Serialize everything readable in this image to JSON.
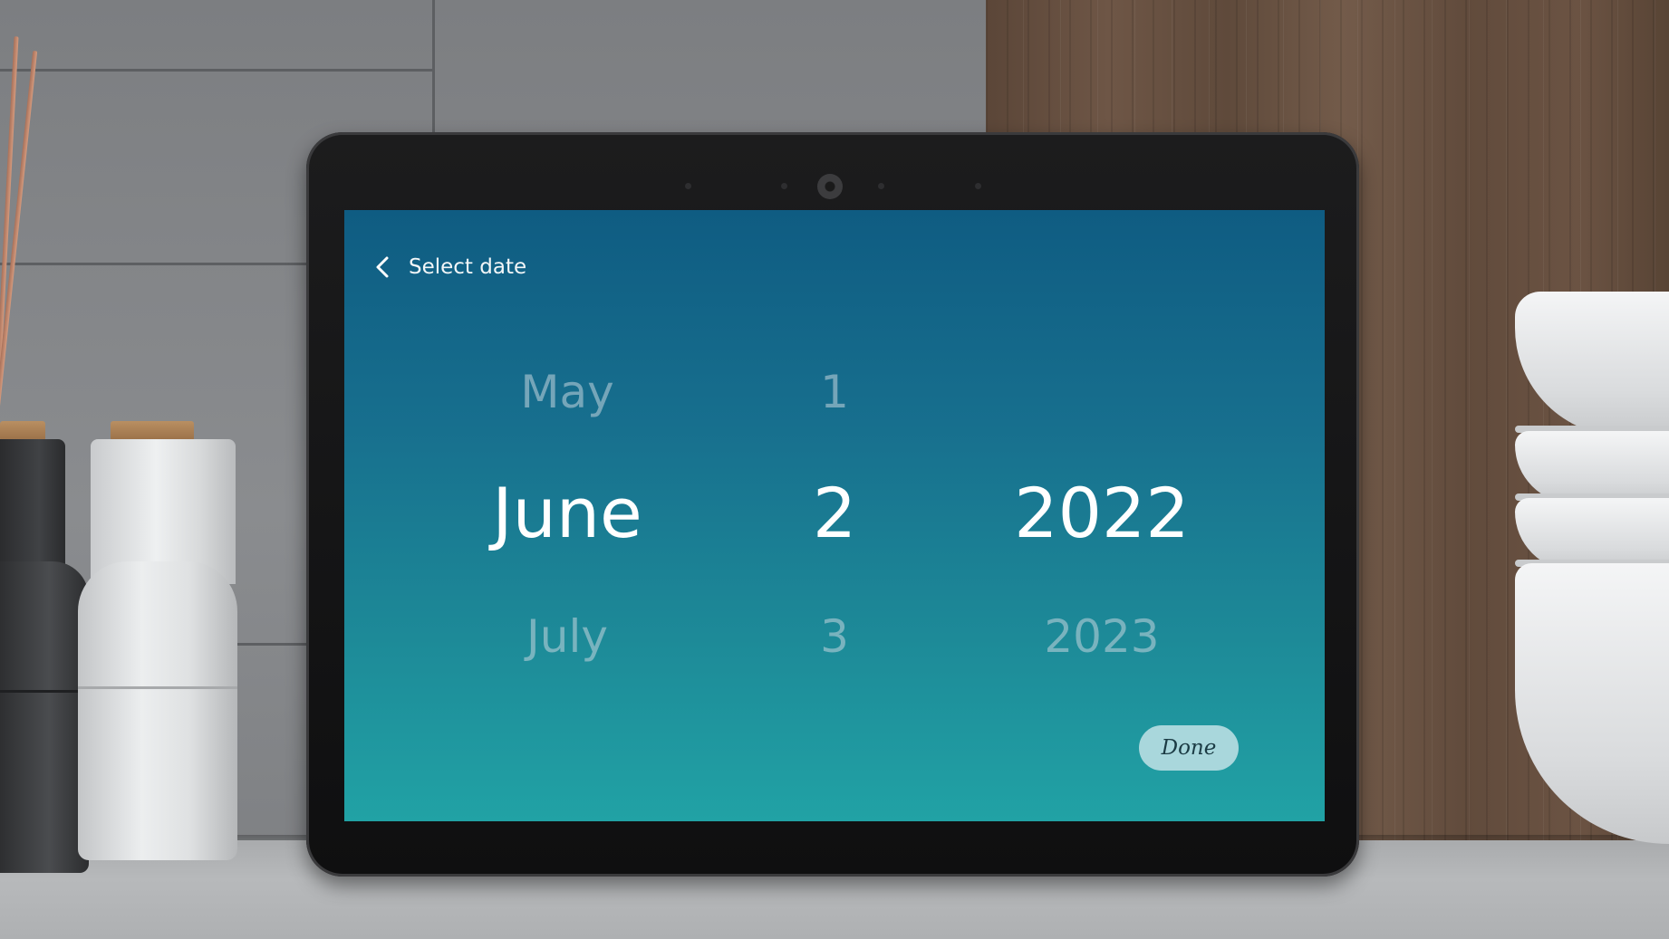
{
  "screen": {
    "title": "Select date",
    "back_icon": "chevron-left-icon",
    "month_picker": {
      "previous": "May",
      "selected": "June",
      "next": "July"
    },
    "day_picker": {
      "previous": "1",
      "selected": "2",
      "next": "3"
    },
    "year_picker": {
      "previous": "",
      "selected": "2022",
      "next": "2023"
    },
    "done_label": "Done"
  },
  "colors": {
    "screen_gradient_top": "#0f5c82",
    "screen_gradient_bottom": "#21a2a5",
    "done_button_bg": "#a9d7dc",
    "selected_text": "#ffffff"
  }
}
